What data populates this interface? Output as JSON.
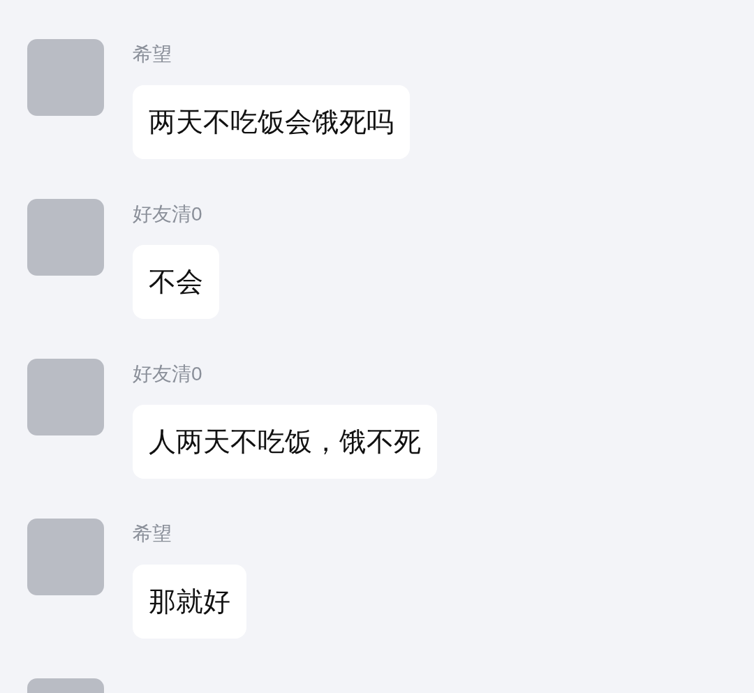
{
  "messages": [
    {
      "sender": "希望",
      "text": "两天不吃饭会饿死吗"
    },
    {
      "sender": "好友清0",
      "text": "不会"
    },
    {
      "sender": "好友清0",
      "text": "人两天不吃饭，饿不死"
    },
    {
      "sender": "希望",
      "text": "那就好"
    }
  ],
  "more_below": true
}
